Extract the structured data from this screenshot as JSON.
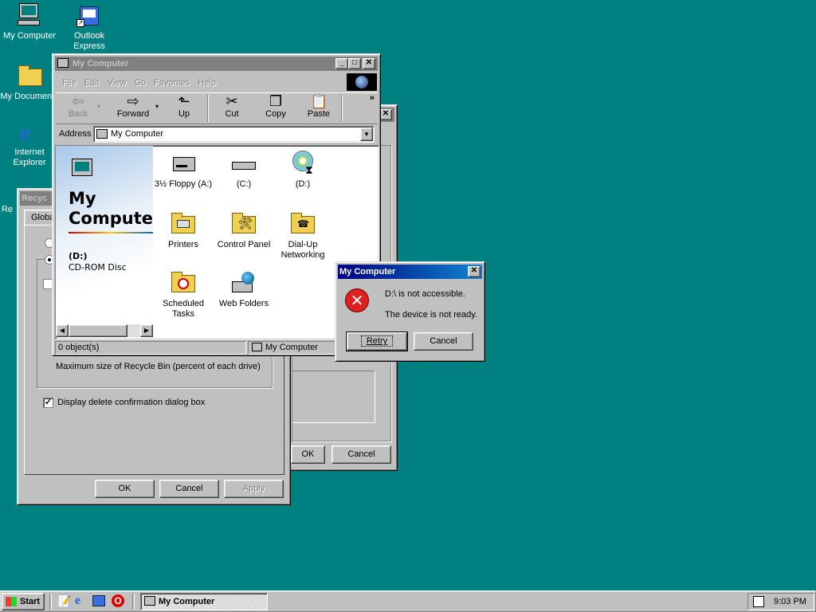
{
  "desktop": {
    "icons": [
      {
        "label": "My Computer"
      },
      {
        "label": "Outlook Express"
      },
      {
        "label": "My Documents"
      },
      {
        "label": "Internet Explorer"
      },
      {
        "label": "Re"
      }
    ]
  },
  "explorer": {
    "title": "My Computer",
    "menu": [
      "File",
      "Edit",
      "View",
      "Go",
      "Favorites",
      "Help"
    ],
    "toolbar": {
      "back": "Back",
      "forward": "Forward",
      "up": "Up",
      "cut": "Cut",
      "copy": "Copy",
      "paste": "Paste",
      "more": "»"
    },
    "address_label": "Address",
    "address_value": "My Computer",
    "panel": {
      "title_line1": "My",
      "title_line2": "Compute",
      "selected_name": "(D:)",
      "selected_type": "CD-ROM Disc"
    },
    "items": [
      {
        "label": "3½ Floppy (A:)",
        "icon": "floppy-drive-icon"
      },
      {
        "label": "(C:)",
        "icon": "hard-drive-icon"
      },
      {
        "label": "(D:)",
        "icon": "cdrom-drive-icon"
      },
      {
        "label": "Printers",
        "icon": "printers-folder-icon"
      },
      {
        "label": "Control Panel",
        "icon": "control-panel-icon"
      },
      {
        "label": "Dial-Up Networking",
        "icon": "dialup-networking-icon"
      },
      {
        "label": "Scheduled Tasks",
        "icon": "scheduled-tasks-icon"
      },
      {
        "label": "Web Folders",
        "icon": "web-folders-icon"
      }
    ],
    "status_left": "0 object(s)",
    "status_right": "My Computer"
  },
  "recycle": {
    "title": "Recyc",
    "tab": "Globa",
    "max_size_label": "Maximum size of Recycle Bin (percent of each drive)",
    "confirm_label": "Display delete confirmation dialog box",
    "confirm_checked": true,
    "ok": "OK",
    "cancel": "Cancel",
    "apply": "Apply"
  },
  "backdialog": {
    "ok": "OK",
    "cancel": "Cancel"
  },
  "error": {
    "title": "My Computer",
    "line1": "D:\\ is not accessible.",
    "line2": "The device is not ready.",
    "retry": "Retry",
    "cancel": "Cancel"
  },
  "taskbar": {
    "start": "Start",
    "task": "My Computer",
    "clock": "9:03 PM"
  }
}
